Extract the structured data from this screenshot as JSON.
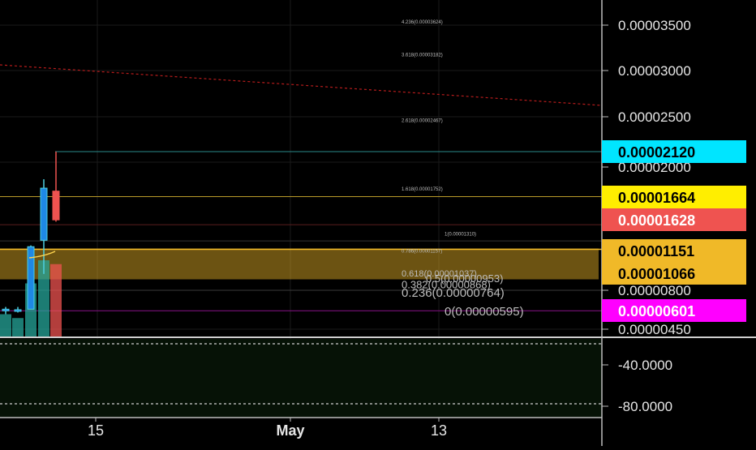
{
  "chart_data": {
    "type": "candlestick",
    "price_axis": {
      "ticks": [
        "0.00003500",
        "0.00003000",
        "0.00002500",
        "0.00002000",
        "0.00000800",
        "0.00000450"
      ]
    },
    "time_axis": {
      "ticks": [
        "15",
        "May",
        "13"
      ]
    },
    "candles": [
      {
        "open": 6.15e-06,
        "high": 6.5e-06,
        "low": 5.85e-06,
        "close": 6.3e-06,
        "up": true
      },
      {
        "open": 6.15e-06,
        "high": 6.5e-06,
        "low": 6e-06,
        "close": 6.25e-06,
        "up": true
      },
      {
        "open": 6.3e-06,
        "high": 1.23e-05,
        "low": 6.3e-06,
        "close": 1.21e-05,
        "up": true
      },
      {
        "open": 1.31e-05,
        "high": 1.84e-05,
        "low": 1.04e-05,
        "close": 1.75e-05,
        "up": true
      },
      {
        "open": 1.72e-05,
        "high": 2.12e-05,
        "low": 1.6e-05,
        "close": 1.628e-05,
        "up": false
      }
    ],
    "price_labels": [
      {
        "text": "0.00002120",
        "price": 2.12e-05,
        "bg": "#00e5ff",
        "fg": "#000000"
      },
      {
        "text": "0.00001664",
        "price": 1.664e-05,
        "bg": "#ffee00",
        "fg": "#000000"
      },
      {
        "text": "0.00001628",
        "price": 1.628e-05,
        "bg": "#ef5350",
        "fg": "#ffffff"
      },
      {
        "text": "0.00001151",
        "price": 1.151e-05,
        "bg": "#f0b928",
        "fg": "#000000"
      },
      {
        "text": "0.00001066",
        "price": 1.066e-05,
        "bg": "#f0b928",
        "fg": "#000000"
      },
      {
        "text": "0.00000601",
        "price": 6.01e-06,
        "bg": "#ff00ff",
        "fg": "#ffffff"
      }
    ],
    "fib_levels": [
      {
        "label": "4.236(0.00003624)",
        "price": 3.624e-05,
        "size": "xs"
      },
      {
        "label": "3.618(0.00003182)",
        "price": 3.182e-05,
        "size": "xs"
      },
      {
        "label": "2.618(0.00002467)",
        "price": 2.467e-05,
        "size": "xs"
      },
      {
        "label": "1.618(0.00001752)",
        "price": 1.752e-05,
        "size": "xs"
      },
      {
        "label": "1(0.00001310)",
        "price": 1.31e-05,
        "size": "xs"
      },
      {
        "label": "0.786(0.00001157)",
        "price": 1.157e-05,
        "size": "xs"
      },
      {
        "label": "0.618(0.00001037)",
        "price": 1.037e-05,
        "size": "s"
      },
      {
        "label": "0.5(0.00000953)",
        "price": 9.53e-06,
        "size": "m"
      },
      {
        "label": "0.382(0.00000868)",
        "price": 8.68e-06,
        "size": "m"
      },
      {
        "label": "0.236(0.00000764)",
        "price": 7.64e-06,
        "size": "l"
      },
      {
        "label": "0(0.00000595)",
        "price": 5.95e-06,
        "size": "l"
      }
    ],
    "volumes": [
      0.3,
      0.25,
      0.7,
      1.0,
      0.95
    ],
    "volume_colors": [
      "#26a69a",
      "#26a69a",
      "#26a69a",
      "#26a69a",
      "#ef5350"
    ],
    "oscillator": {
      "ticks": [
        "-40.0000",
        "-80.0000"
      ]
    }
  },
  "colors": {
    "background": "#000000",
    "up": "#26a69a",
    "down": "#ef5350",
    "candle_up_fill": "#1e88e5",
    "fib_band": "#f0b928",
    "cyan_line": "#00e5ff",
    "magenta_line": "#ff00ff",
    "red_trend": "#b71c1c"
  }
}
